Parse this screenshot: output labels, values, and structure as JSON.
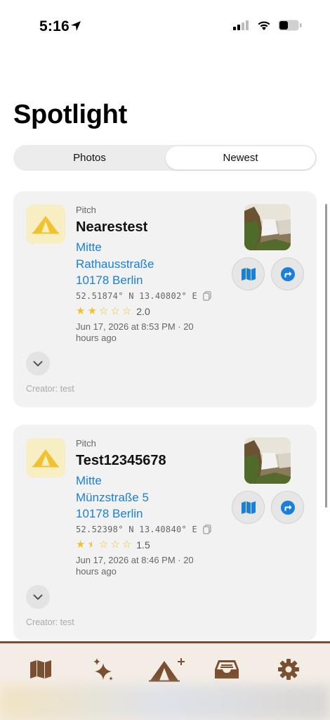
{
  "status_bar": {
    "time": "5:16"
  },
  "page": {
    "title": "Spotlight"
  },
  "segmented": {
    "options": [
      "Photos",
      "Newest"
    ],
    "selected": "Newest"
  },
  "cards": [
    {
      "type": "Pitch",
      "name": "Nearestest",
      "district": "Mitte",
      "street": "Rathausstraße",
      "city": "10178 Berlin",
      "coords": "52.51874° N 13.40802° E",
      "rating": 2.0,
      "rating_text": "2.0",
      "date": "Jun 17, 2026 at 8:53 PM · 20 hours ago",
      "creator": "Creator: test"
    },
    {
      "type": "Pitch",
      "name": "Test12345678",
      "district": "Mitte",
      "street": "Münzstraße 5",
      "city": "10178 Berlin",
      "coords": "52.52398° N 13.40840° E",
      "rating": 1.5,
      "rating_text": "1.5",
      "date": "Jun 17, 2026 at 8:46 PM · 20 hours ago",
      "creator": "Creator: test"
    }
  ],
  "tab_bar": {
    "items": [
      "map-icon",
      "sparkles-icon",
      "add-pitch-icon",
      "inbox-icon",
      "gear-icon"
    ]
  },
  "colors": {
    "accent_blue": "#1a7fd6",
    "tent_yellow": "#f2c12e",
    "star_yellow": "#f3c02d",
    "tab_brown": "#7a4f2f"
  }
}
